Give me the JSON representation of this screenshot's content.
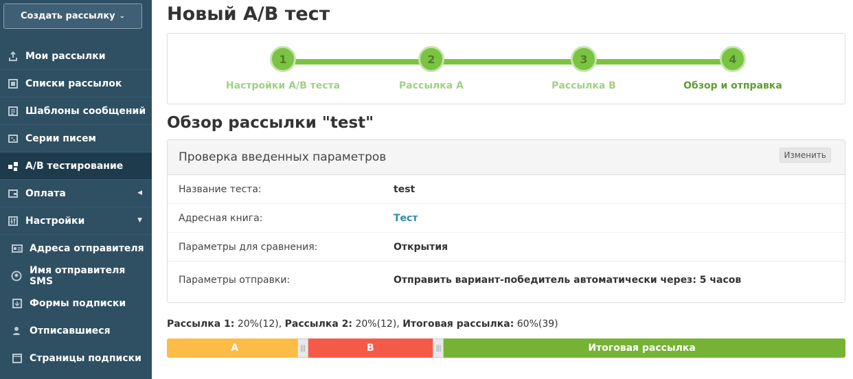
{
  "sidebar": {
    "create_button": "Создать рассылку",
    "items": [
      {
        "label": "Мои рассылки",
        "icon": "upload-icon"
      },
      {
        "label": "Списки рассылок",
        "icon": "list-book-icon"
      },
      {
        "label": "Шаблоны сообщений",
        "icon": "template-icon"
      },
      {
        "label": "Серии писем",
        "icon": "series-icon"
      },
      {
        "label": "А/В тестирование",
        "icon": "ab-test-icon",
        "active": true
      },
      {
        "label": "Оплата",
        "icon": "wallet-icon"
      },
      {
        "label": "Настройки",
        "icon": "sliders-icon"
      }
    ],
    "subitems": [
      {
        "label": "Адреса отправителя",
        "icon": "id-card-icon"
      },
      {
        "label": "Имя отправителя SMS",
        "icon": "user-circle-icon"
      },
      {
        "label": "Формы подписки",
        "icon": "form-icon"
      },
      {
        "label": "Отписавшиеся",
        "icon": "user-remove-icon"
      },
      {
        "label": "Страницы подписки",
        "icon": "page-icon"
      }
    ]
  },
  "page_title": "Новый А/В тест",
  "steps": [
    {
      "number": "1",
      "label": "Настройки А/В теста"
    },
    {
      "number": "2",
      "label": "Рассылка А"
    },
    {
      "number": "3",
      "label": "Рассылка В"
    },
    {
      "number": "4",
      "label": "Обзор и отправка",
      "current": true
    }
  ],
  "section_title": "Обзор рассылки \"test\"",
  "panel": {
    "title": "Проверка введенных параметров",
    "edit_label": "Изменить",
    "rows": [
      {
        "key": "Название теста:",
        "value": "test"
      },
      {
        "key": "Адресная книга:",
        "value": "Тест"
      },
      {
        "key": "Параметры для сравнения:",
        "value": "Открытия"
      },
      {
        "key": "Параметры отправки:",
        "value": "Отправить вариант-победитель автоматически через: 5 часов"
      }
    ]
  },
  "split": {
    "a_label": "Рассылка 1:",
    "a_value": " 20%(12), ",
    "b_label": "Рассылка 2:",
    "b_value": " 20%(12), ",
    "final_label": "Итоговая рассылка:",
    "final_value": " 60%(39)",
    "segments": [
      {
        "label": "A",
        "percent": 20,
        "color": "#fcbc45"
      },
      {
        "label": "B",
        "percent": 20,
        "color": "#f55a49"
      },
      {
        "label": "Итоговая рассылка",
        "percent": 60,
        "color": "#75b334"
      }
    ]
  },
  "colors": {
    "sidebar": "#2f4f63",
    "accent_green": "#7bc342",
    "link": "#2a8ab0"
  }
}
